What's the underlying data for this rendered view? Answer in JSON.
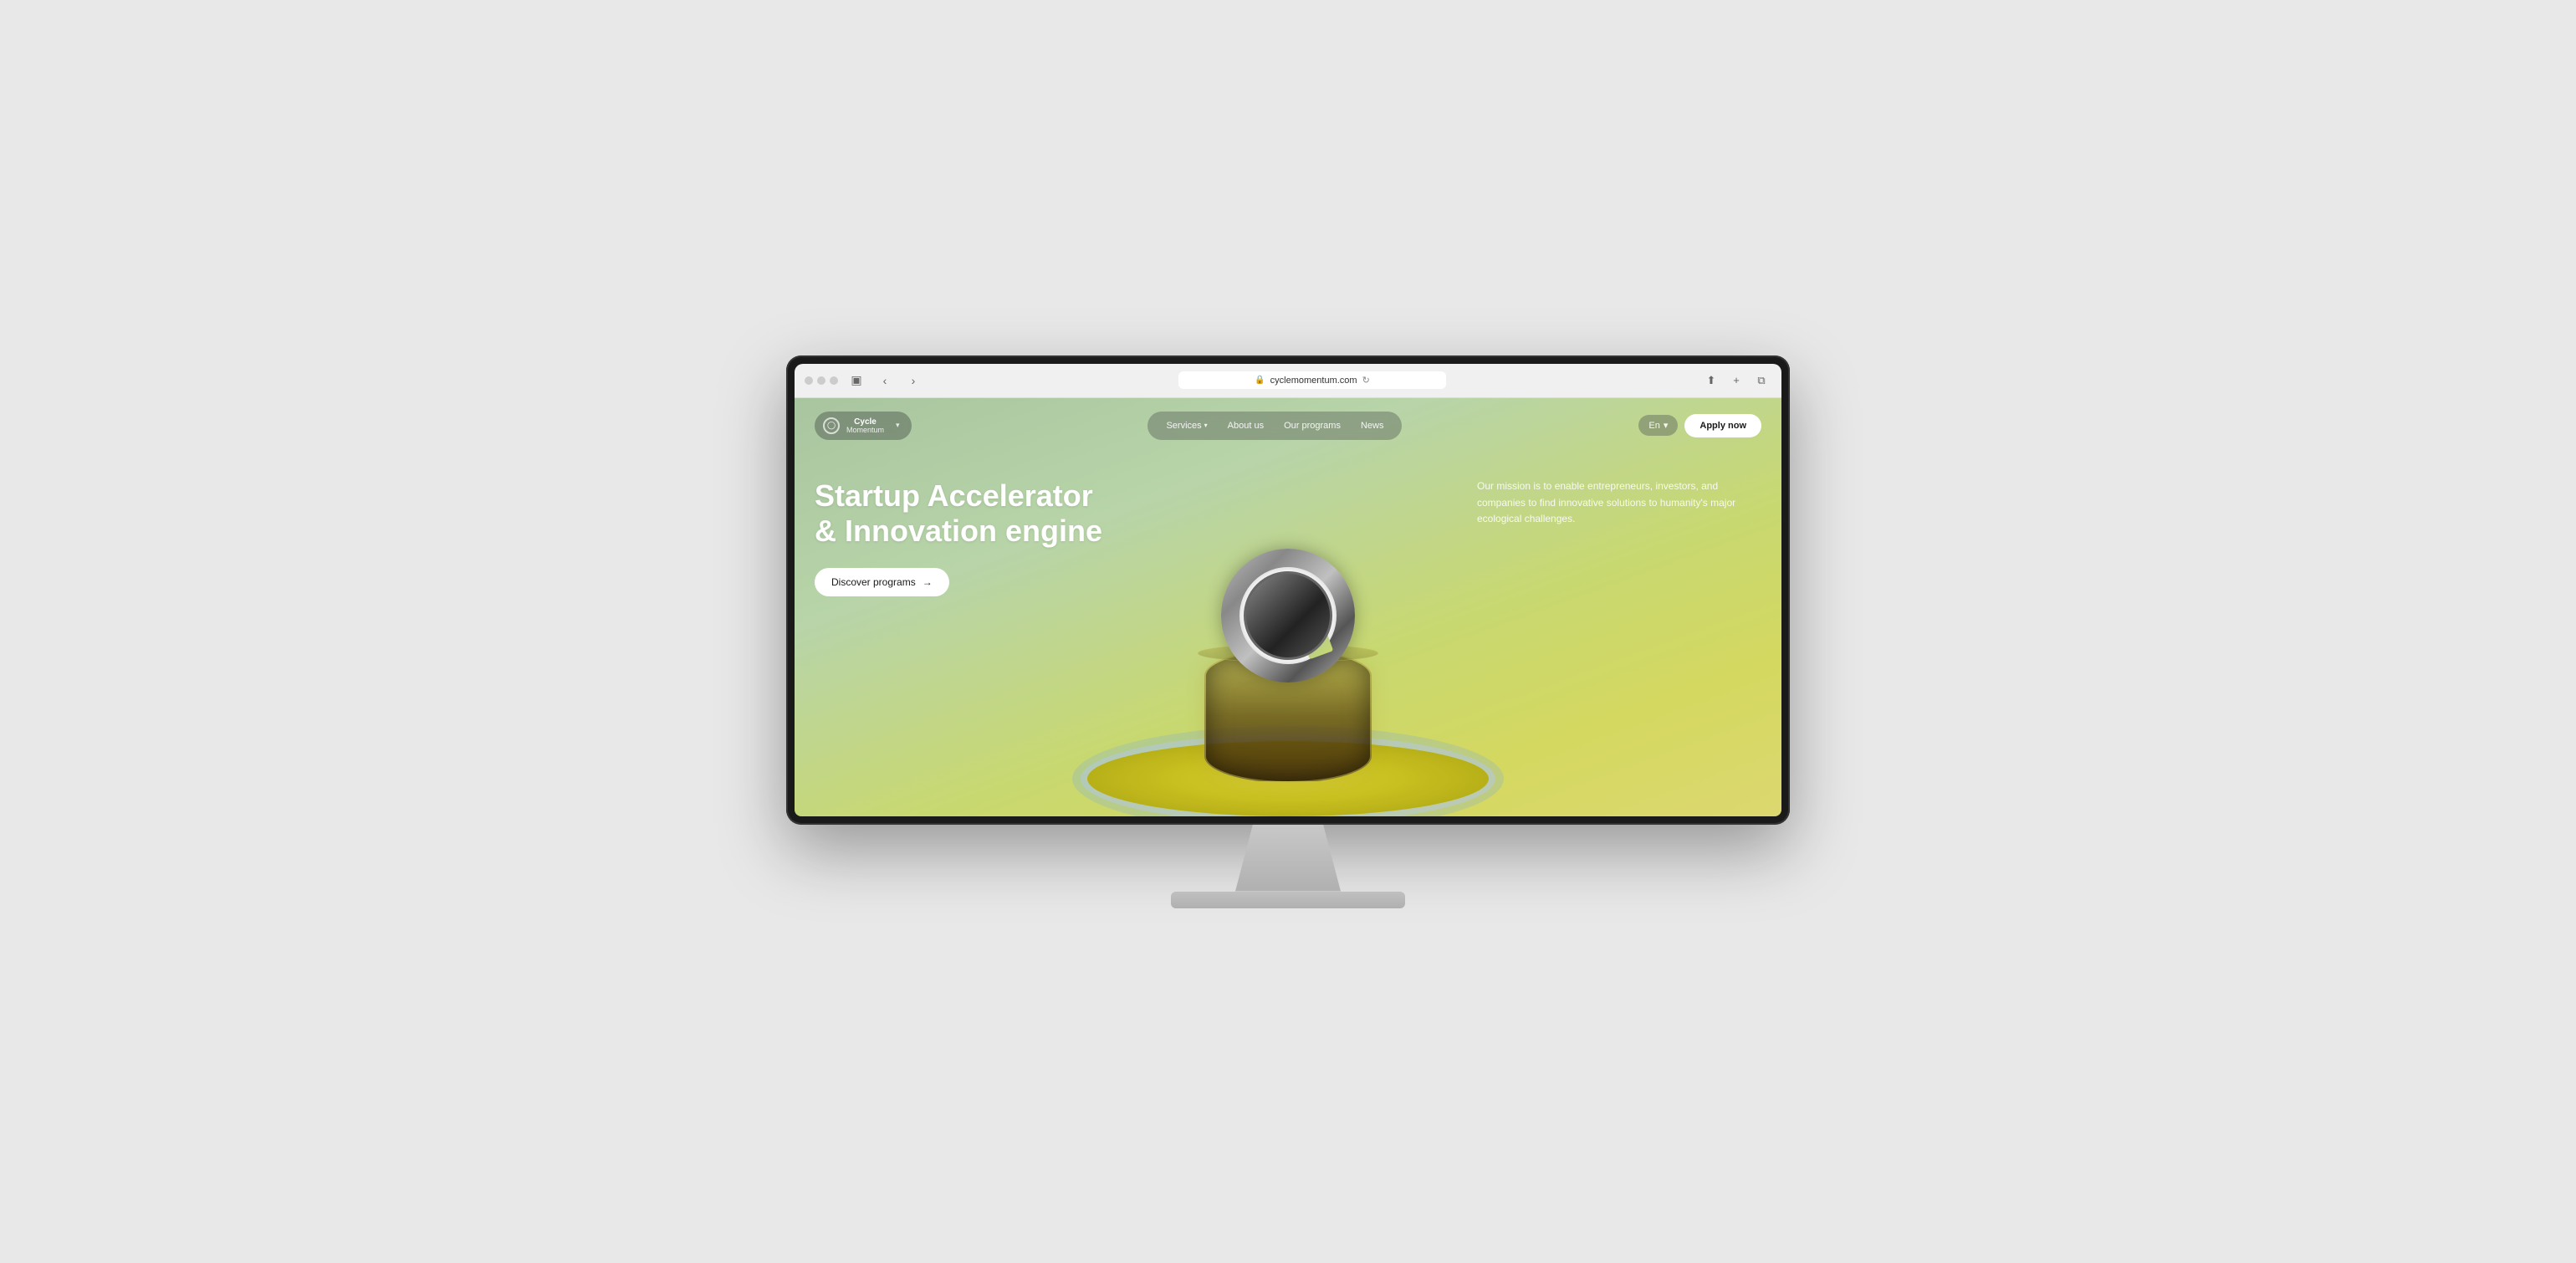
{
  "browser": {
    "url": "cyclemomentum.com",
    "back_icon": "‹",
    "forward_icon": "›",
    "share_icon": "⬆",
    "new_tab_icon": "+",
    "sidebar_icon": "▣",
    "reload_icon": "↻",
    "lock_icon": "🔒"
  },
  "nav": {
    "logo_line1": "Cycle",
    "logo_line2": "Momentum",
    "logo_chevron": "▾",
    "items": [
      {
        "label": "Services",
        "has_chevron": true
      },
      {
        "label": "About us",
        "has_chevron": false
      },
      {
        "label": "Our programs",
        "has_chevron": false
      },
      {
        "label": "News",
        "has_chevron": false
      }
    ],
    "lang_label": "En",
    "lang_chevron": "▾",
    "apply_label": "Apply now"
  },
  "hero": {
    "title_line1": "Startup Accelerator",
    "title_line2": "& Innovation engine",
    "description": "Our mission is to enable entrepreneurs, investors, and companies to find innovative solutions to  humanity's major ecological challenges.",
    "discover_btn": "Discover programs",
    "discover_arrow": "→"
  }
}
